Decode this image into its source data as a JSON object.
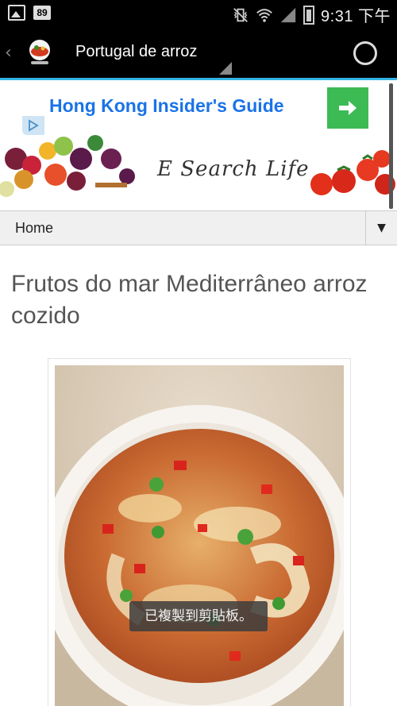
{
  "status_bar": {
    "notification_badge": "89",
    "time": "9:31 下午"
  },
  "action_bar": {
    "title": "Portugal de arroz"
  },
  "ad": {
    "text": "Hong Kong Insider's Guide",
    "button_color": "#3cba54",
    "text_color": "#1a73e8"
  },
  "banner": {
    "text": "E Search Life"
  },
  "nav": {
    "selected": "Home"
  },
  "article": {
    "title": "Frutos do mar Mediterrâneo arroz cozido"
  },
  "toast": {
    "message": "已複製到剪貼板。"
  },
  "colors": {
    "accent": "#33b5e5",
    "action_bar_bg": "#000000"
  }
}
